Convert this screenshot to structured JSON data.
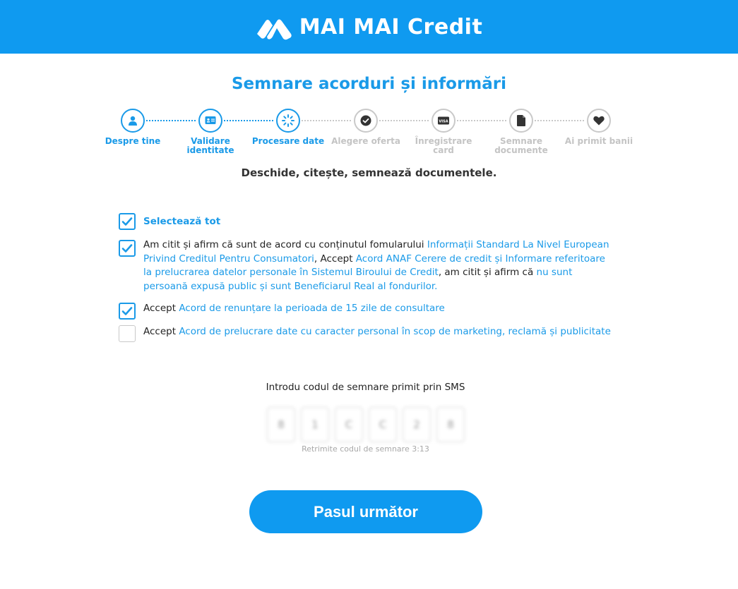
{
  "header": {
    "brand": "MAI MAI Credit",
    "logo_icon": "brand-logo-icon"
  },
  "page_title": "Semnare acorduri și informări",
  "steps": [
    {
      "label_1": "Despre tine",
      "label_2": "",
      "state": "done",
      "icon": "user-icon"
    },
    {
      "label_1": "Validare",
      "label_2": "identitate",
      "state": "done",
      "icon": "id-card-icon"
    },
    {
      "label_1": "Procesare date",
      "label_2": "",
      "state": "active",
      "icon": "spinner-icon"
    },
    {
      "label_1": "Alegere oferta",
      "label_2": "",
      "state": "todo",
      "icon": "check-circle-icon"
    },
    {
      "label_1": "Înregistrare",
      "label_2": "card",
      "state": "todo",
      "icon": "card-icon"
    },
    {
      "label_1": "Semnare",
      "label_2": "documente",
      "state": "todo",
      "icon": "document-icon"
    },
    {
      "label_1": "Ai primit banii",
      "label_2": "",
      "state": "todo",
      "icon": "heart-icon"
    }
  ],
  "subtitle": "Deschide, citește, semnează documentele.",
  "agreements": {
    "select_all": {
      "label": "Selectează tot",
      "checked": true
    },
    "main": {
      "checked": true,
      "t1": "Am citit și afirm că sunt de acord cu conținutul fomularului ",
      "l1": "Informații Standard La Nivel European Privind Creditul Pentru Consumatori",
      "t2": ", Accept ",
      "l2": "Acord ANAF Cerere de credit",
      "t3": " ",
      "l3": "și Informare referitoare la prelucrarea datelor personale în Sistemul Biroului de Credit",
      "t4": ", am citit și afirm că ",
      "l4": "nu sunt persoană expusă public și sunt Beneficiarul Real al fondurilor."
    },
    "consult": {
      "checked": true,
      "t1": "Accept ",
      "l1": "Acord de renunțare la perioada de 15 zile de consultare"
    },
    "marketing": {
      "checked": false,
      "t1": "Accept ",
      "l1": "Acord de prelucrare date cu caracter personal în scop de marketing, reclamă și publicitate"
    }
  },
  "sms": {
    "label": "Introdu codul de semnare primit prin SMS",
    "digits": [
      "8",
      "1",
      "C",
      "C",
      "2",
      "8"
    ],
    "resend": "Retrimite codul de semnare 3:13"
  },
  "next_button": "Pasul următor",
  "colors": {
    "primary": "#0f9af0",
    "link": "#1a9ae8",
    "inactive": "#c4c4c4"
  }
}
